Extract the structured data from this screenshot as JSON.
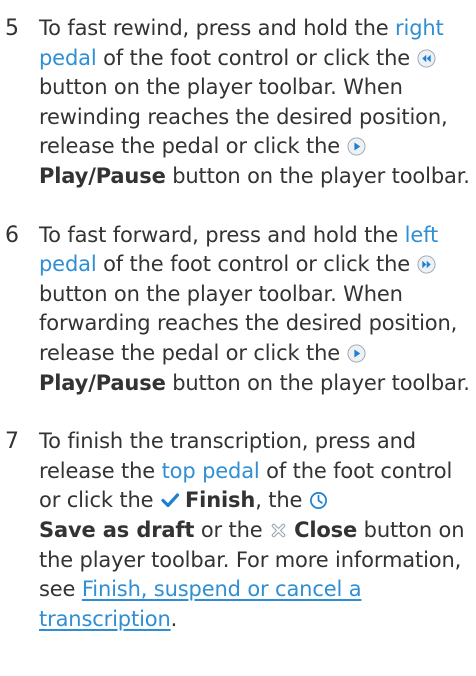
{
  "steps": [
    {
      "number": "5",
      "t1": "To fast rewind, press and hold the ",
      "link": "right pedal",
      "t2": " of the foot control or click the ",
      "t3": " button on the player toolbar. When rewinding reaches the desired position, release the pedal or click the ",
      "bold": "Play/Pause",
      "t4": " button on the player toolbar.",
      "icon_a": "rewind-icon",
      "icon_b": "play-icon"
    },
    {
      "number": "6",
      "t1": "To fast forward, press and hold the ",
      "link": "left pedal",
      "t2": " of the foot control or click the ",
      "t3": " button on the player toolbar. When forwarding reaches the desired position, release the pedal or click the ",
      "bold": "Play/Pause",
      "t4": " button on the player toolbar.",
      "icon_a": "fast-forward-icon",
      "icon_b": "play-icon"
    },
    {
      "number": "7",
      "t1": "To finish the transcription, press and release the ",
      "link": "top pedal",
      "t2": " of the foot control or click the ",
      "finish": "Finish",
      "t3": ", the ",
      "save": "Save as draft",
      "t4": " or the ",
      "close": "Close",
      "t5": " button on the player toolbar. For more information, see ",
      "ulink": "Finish, suspend or cancel a transcription",
      "t6": ".",
      "icons": [
        "checkmark-icon",
        "clock-icon",
        "close-icon"
      ]
    }
  ],
  "colors": {
    "text": "#333333",
    "link": "#2f8fd4",
    "icon_blue": "#1f7fd0"
  }
}
